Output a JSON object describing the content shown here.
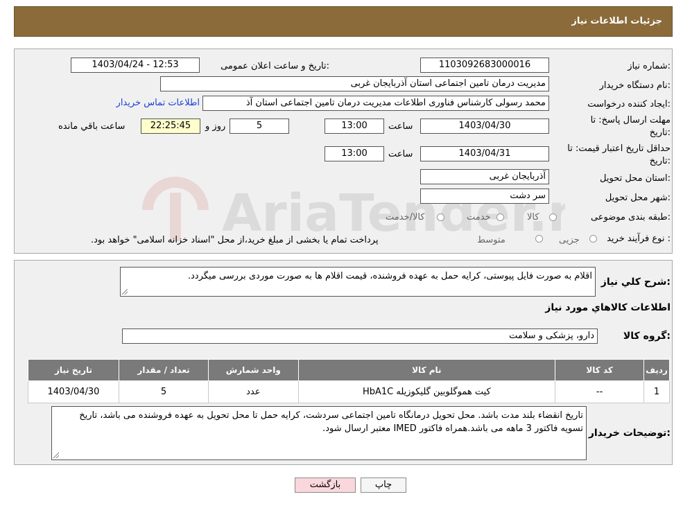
{
  "header": {
    "title": "جزئیات اطلاعات نیاز"
  },
  "form": {
    "need_number": {
      "label": "شماره نیاز:",
      "value": "1103092683000016"
    },
    "announce_datetime": {
      "label": "تاریخ و ساعت اعلان عمومی:",
      "value": "1403/04/24 - 12:53"
    },
    "buyer_org": {
      "label": "نام دستگاه خریدار:",
      "value": "مدیریت درمان تامین اجتماعی استان آذربایجان غربی"
    },
    "requester": {
      "label": "ایجاد کننده درخواست:",
      "value": "محمد رسولی کارشناس فناوری اطلاعات مدیریت درمان تامین اجتماعی استان آذ",
      "contact_link": "اطلاعات تماس خریدار"
    },
    "reply_deadline": {
      "label_line1": "مهلت ارسال پاسخ: تا",
      "label_line2": "تاریخ:",
      "date": "1403/04/30",
      "time_label": "ساعت",
      "time": "13:00",
      "days": "5",
      "days_label": "روز و",
      "remaining": "22:25:45",
      "remaining_label": "ساعت باقي مانده"
    },
    "price_validity": {
      "label_line1": "حداقل تاریخ اعتبار قیمت: تا",
      "label_line2": "تاریخ:",
      "date": "1403/04/31",
      "time_label": "ساعت",
      "time": "13:00"
    },
    "delivery_province": {
      "label": "استان محل تحویل:",
      "value": "آذربایجان غربی"
    },
    "delivery_city": {
      "label": "شهر محل تحویل:",
      "value": "سر دشت"
    },
    "category": {
      "label": "طبقه بندی موضوعی:",
      "options": [
        "کالا",
        "خدمت",
        "کالا/خدمت"
      ]
    },
    "purchase_type": {
      "label": "نوع فرآیند خرید :",
      "options": [
        "جزیی",
        "متوسط"
      ],
      "note": "پرداخت تمام یا بخشی از مبلغ خرید،از محل \"اسناد خزانه اسلامی\" خواهد بود."
    }
  },
  "description": {
    "label": "شرح کلي نياز:",
    "value": "اقلام به صورت فایل پیوستی، کرایه حمل به عهده فروشنده، قیمت اقلام ها به صورت موردی بررسی میگردد."
  },
  "items_section": {
    "title": "اطلاعات کالاهاي مورد نياز",
    "group_label": "گروه کالا:",
    "group_value": "دارو، پزشکی و سلامت",
    "table": {
      "headers": [
        "ردیف",
        "کد کالا",
        "نام کالا",
        "واحد شمارش",
        "تعداد / مقدار",
        "تاریخ نیاز"
      ],
      "rows": [
        [
          "1",
          "--",
          "کیت هموگلوبین گلیکوزیله HbA1C",
          "عدد",
          "5",
          "1403/04/30"
        ]
      ]
    },
    "buyer_notes_label": "توضیحات خریدار:",
    "buyer_notes": "تاریخ انقضاء بلند مدت باشد. محل تحویل درمانگاه تامین اجتماعی سردشت، کرایه حمل تا محل تحویل به عهده فروشنده می باشد، تاریخ تسویه فاکتور 3 ماهه می باشد.همراه فاکتور IMED معتبر ارسال شود."
  },
  "buttons": {
    "print": "چاپ",
    "back": "بازگشت"
  },
  "watermark": {
    "text": "AriaTender.neT"
  },
  "colors": {
    "header_bg": "#8b6b3a",
    "table_header_bg": "#7a7a7a",
    "link": "#1a3fd9",
    "back_button_bg": "#f9d7dc"
  }
}
